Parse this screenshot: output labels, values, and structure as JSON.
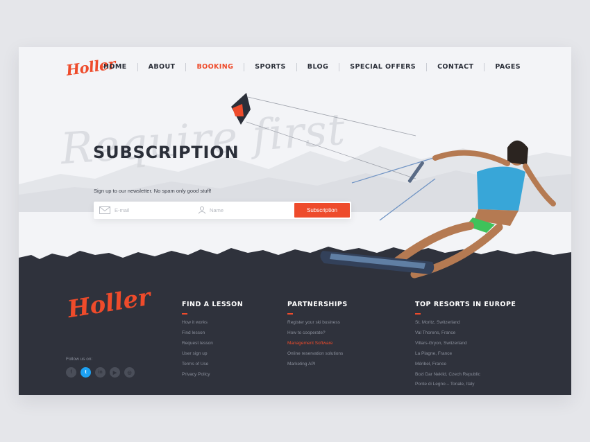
{
  "brand": {
    "logo_text": "Holler",
    "accent": "#ee4b2b"
  },
  "nav": {
    "items": [
      {
        "label": "HOME",
        "active": false
      },
      {
        "label": "ABOUT",
        "active": false
      },
      {
        "label": "BOOKING",
        "active": true
      },
      {
        "label": "SPORTS",
        "active": false
      },
      {
        "label": "BLOG",
        "active": false
      },
      {
        "label": "SPECIAL OFFERS",
        "active": false
      },
      {
        "label": "CONTACT",
        "active": false
      },
      {
        "label": "PAGES",
        "active": false
      }
    ]
  },
  "hero": {
    "background_script": "Require first",
    "title": "SUBSCRIPTION",
    "subtitle": "Sign up to our newsletter. No spam only good stuff!",
    "email_placeholder": "E-mail",
    "name_placeholder": "Name",
    "button_label": "Subscription"
  },
  "footer": {
    "logo_text": "Holler",
    "follow_label": "Follow us on:",
    "socials": [
      {
        "icon": "facebook-icon",
        "glyph": "f",
        "active": false
      },
      {
        "icon": "twitter-icon",
        "glyph": "t",
        "active": true
      },
      {
        "icon": "linkedin-icon",
        "glyph": "in",
        "active": false
      },
      {
        "icon": "youtube-icon",
        "glyph": "▶",
        "active": false
      },
      {
        "icon": "instagram-icon",
        "glyph": "◎",
        "active": false
      }
    ],
    "columns": [
      {
        "title": "FIND A LESSON",
        "links": [
          {
            "label": "How it works",
            "highlight": false
          },
          {
            "label": "Find lesson",
            "highlight": false
          },
          {
            "label": "Request lesson",
            "highlight": false
          },
          {
            "label": "User sign up",
            "highlight": false
          },
          {
            "label": "Terms of Use",
            "highlight": false
          },
          {
            "label": "Privacy Policy",
            "highlight": false
          }
        ]
      },
      {
        "title": "PARTNERSHIPS",
        "links": [
          {
            "label": "Register your ski business",
            "highlight": false
          },
          {
            "label": "How to cooperate?",
            "highlight": false
          },
          {
            "label": "Management Software",
            "highlight": true
          },
          {
            "label": "Online reservation solutions",
            "highlight": false
          },
          {
            "label": "Marketing API",
            "highlight": false
          }
        ]
      },
      {
        "title": "TOP RESORTS IN EUROPE",
        "links": [
          {
            "label": "St. Moritz, Switzerland",
            "highlight": false
          },
          {
            "label": "Val Thorens, France",
            "highlight": false
          },
          {
            "label": "Villars-Gryon, Switzerland",
            "highlight": false
          },
          {
            "label": "La Plagne, France",
            "highlight": false
          },
          {
            "label": "Méribel, France",
            "highlight": false
          },
          {
            "label": "Bozi Dar Neklid, Czech Republic",
            "highlight": false
          },
          {
            "label": "Ponte di Legno – Tonale, Italy",
            "highlight": false
          }
        ]
      }
    ]
  }
}
